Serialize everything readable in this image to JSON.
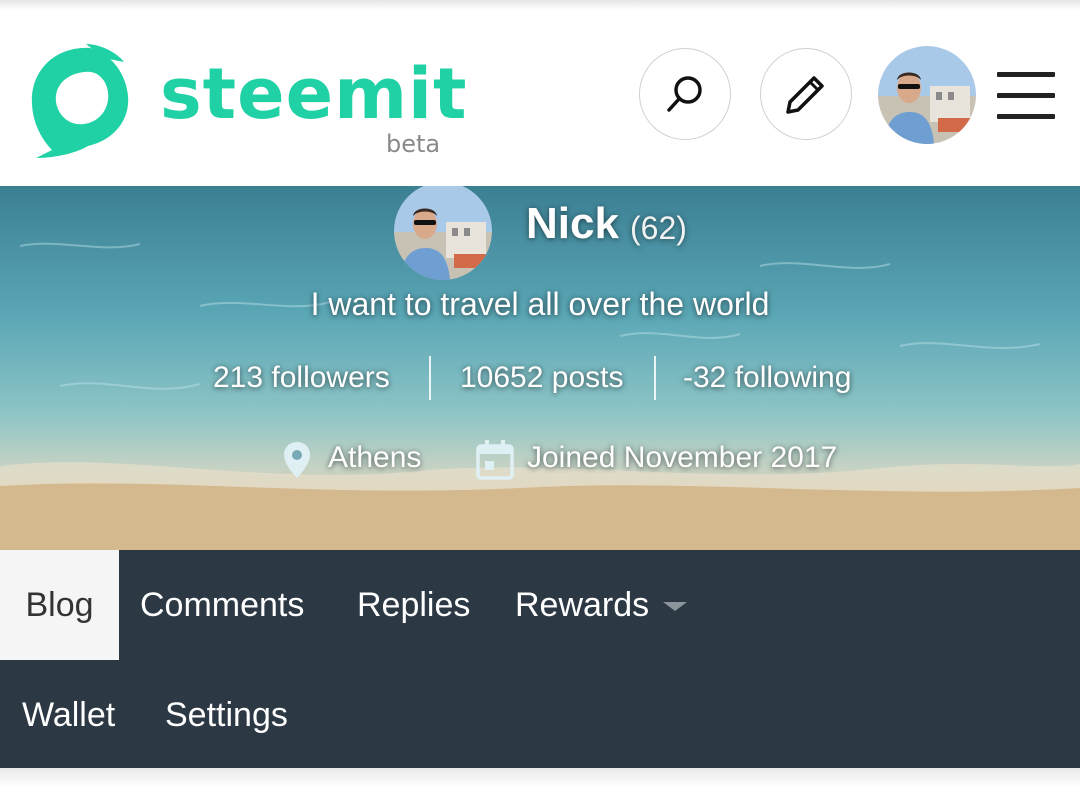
{
  "header": {
    "logo_text": "steemit",
    "logo_sub": "beta",
    "brand_color": "#1fd1a4",
    "icons": [
      "search-icon",
      "pencil-icon",
      "menu-icon"
    ]
  },
  "profile": {
    "name": "Nick",
    "reputation": "(62)",
    "about": "I want to travel all over the world",
    "stats": {
      "followers": "213 followers",
      "posts": "10652 posts",
      "following": "-32 following"
    },
    "location": "Athens",
    "joined": "Joined November 2017"
  },
  "tabs": {
    "blog": "Blog",
    "comments": "Comments",
    "replies": "Replies",
    "rewards": "Rewards",
    "wallet": "Wallet",
    "settings": "Settings",
    "active": "Blog"
  },
  "colors": {
    "tab_bar": "#2c3844",
    "active_tab_bg": "#f5f5f5"
  }
}
